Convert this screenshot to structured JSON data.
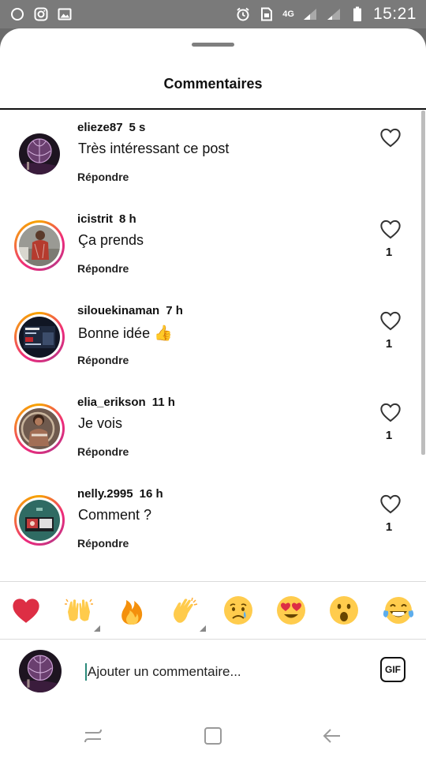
{
  "status_bar": {
    "time": "15:21",
    "network_1": "4G",
    "icons_left": [
      "circle-icon",
      "instagram-icon",
      "image-icon"
    ],
    "icons_right": [
      "alarm-icon",
      "sim-icon",
      "signal-icon",
      "signal-icon",
      "battery-icon"
    ]
  },
  "sheet": {
    "title": "Commentaires"
  },
  "comments": [
    {
      "username": "elieze87",
      "time": "5 s",
      "text": "Très intéressant ce post",
      "reply_label": "Répondre",
      "likes": ""
    },
    {
      "username": "icistrit",
      "time": "8 h",
      "text": "Ça prends",
      "reply_label": "Répondre",
      "likes": "1"
    },
    {
      "username": "silouekinaman",
      "time": "7 h",
      "text": "Bonne idée",
      "emoji": "👍",
      "reply_label": "Répondre",
      "likes": "1"
    },
    {
      "username": "elia_erikson",
      "time": "11 h",
      "text": "Je vois",
      "reply_label": "Répondre",
      "likes": "1"
    },
    {
      "username": "nelly.2995",
      "time": "16 h",
      "text": "Comment ?",
      "reply_label": "Répondre",
      "likes": "1"
    }
  ],
  "emoji_bar": [
    "❤️",
    "🙌",
    "🔥",
    "👏",
    "😢",
    "😍",
    "😮",
    "😂"
  ],
  "composer": {
    "placeholder": "Ajouter un commentaire...",
    "gif_label": "GIF"
  },
  "colors": {
    "status_bar_bg": "#7a7a7a",
    "ring_gradient_start": "#f7a400",
    "ring_gradient_end": "#c13584",
    "caret": "#2b8a7a"
  }
}
